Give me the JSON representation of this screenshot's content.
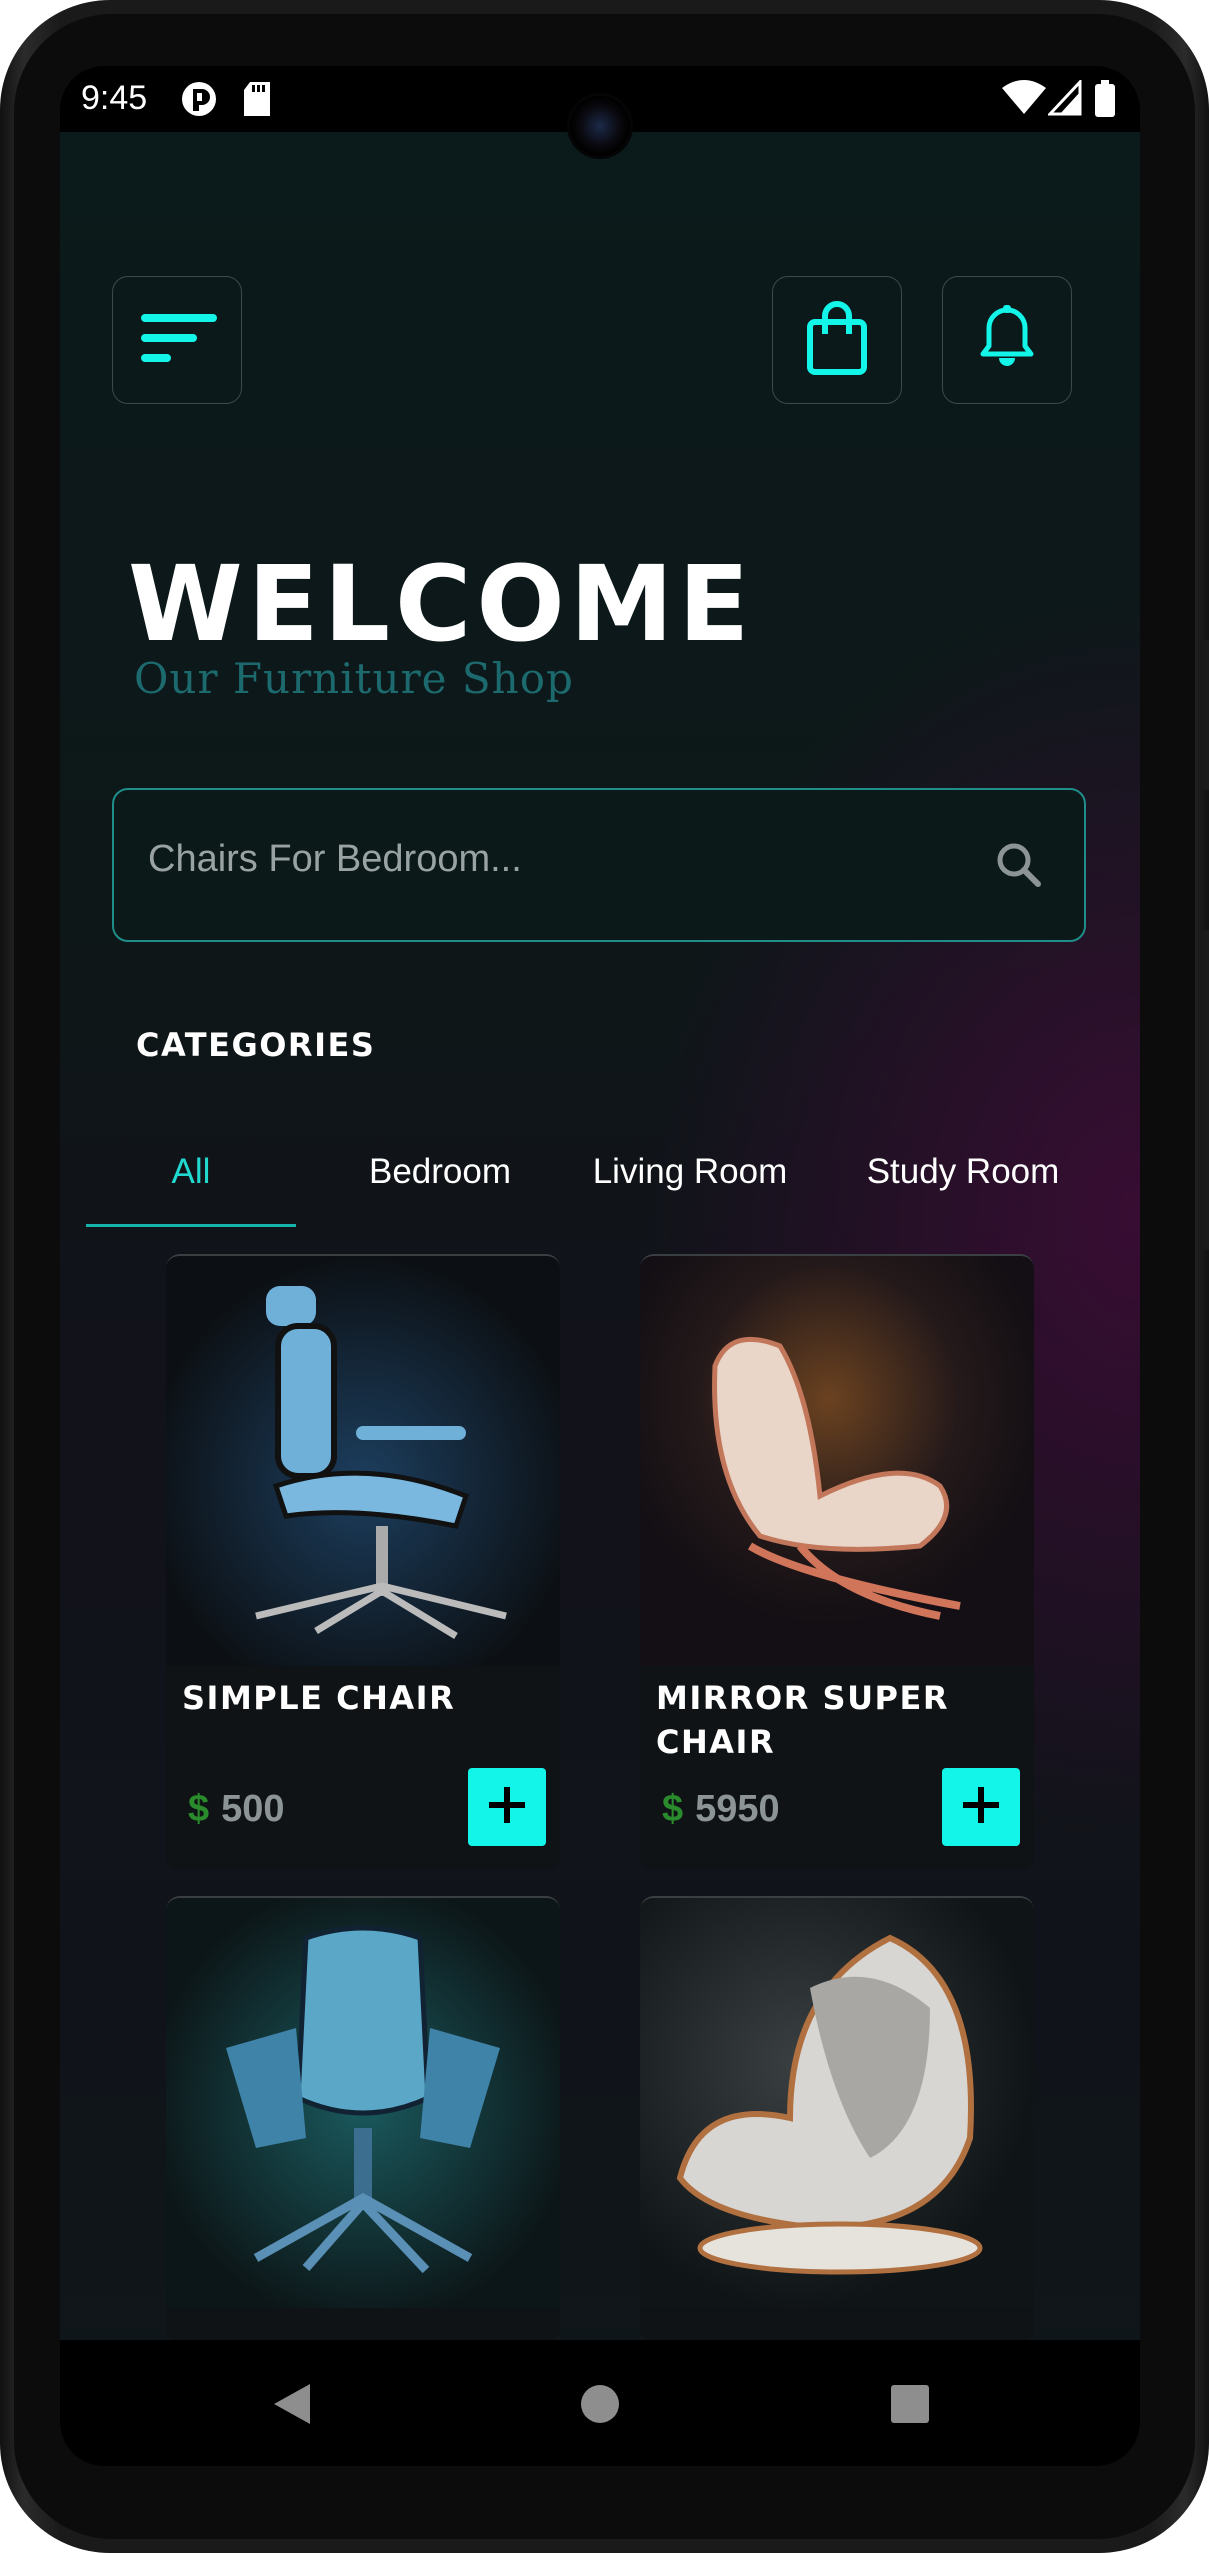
{
  "status_bar": {
    "time": "9:45",
    "left_icons": [
      "notification-app-icon",
      "sd-card-icon"
    ],
    "right_icons": [
      "wifi-icon",
      "signal-icon",
      "battery-icon"
    ]
  },
  "header": {
    "menu_icon": "menu-icon",
    "cart_icon": "shopping-bag-icon",
    "notification_icon": "bell-icon",
    "accent_color": "#12f5e8"
  },
  "hero": {
    "title": "WELCOME",
    "subtitle": "Our Furniture Shop"
  },
  "search": {
    "placeholder": "Chairs For Bedroom...",
    "icon": "search-icon"
  },
  "categories": {
    "title": "CATEGORIES",
    "tabs": [
      {
        "label": "All",
        "active": true
      },
      {
        "label": "Bedroom",
        "active": false
      },
      {
        "label": "Living Room",
        "active": false
      },
      {
        "label": "Study Room",
        "active": false
      }
    ]
  },
  "products": [
    {
      "name": "SIMPLE CHAIR",
      "currency": "$",
      "price": "500"
    },
    {
      "name": "MIRROR SUPER CHAIR",
      "currency": "$",
      "price": "5950"
    },
    {
      "name": "",
      "currency": "",
      "price": ""
    },
    {
      "name": "",
      "currency": "",
      "price": ""
    }
  ],
  "nav_bar": {
    "icons": [
      "back-icon",
      "home-icon",
      "recents-icon"
    ]
  }
}
